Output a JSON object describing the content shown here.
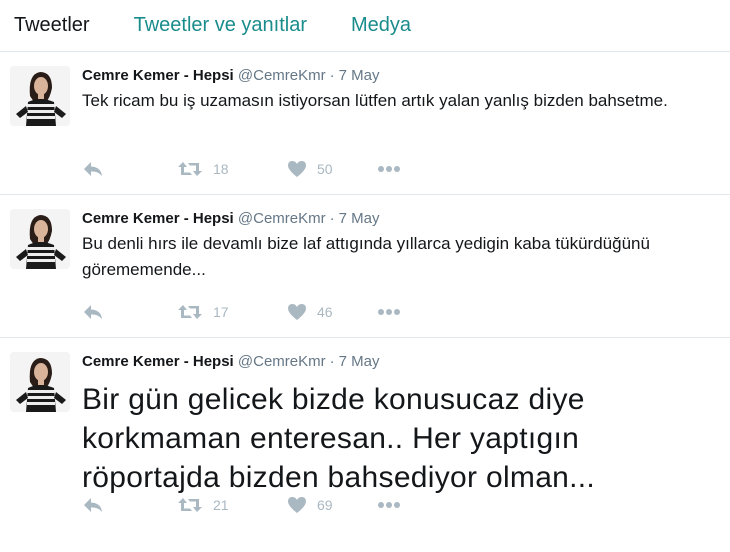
{
  "tabs": [
    {
      "label": "Tweetler",
      "active": true
    },
    {
      "label": "Tweetler ve yanıtlar",
      "active": false
    },
    {
      "label": "Medya",
      "active": false
    }
  ],
  "tweets": [
    {
      "name": "Cemre Kemer - Hepsi",
      "handle": "@CemreKmr",
      "separator": "·",
      "date": "7 May",
      "text": "Tek ricam bu iş uzamasın istiyorsan lütfen artık yalan yanlış bizden bahsetme.",
      "retweets": "18",
      "likes": "50"
    },
    {
      "name": "Cemre Kemer - Hepsi",
      "handle": "@CemreKmr",
      "separator": "·",
      "date": "7 May",
      "text": "Bu denli hırs ile devamlı bize laf attıgında yıllarca  yedigin kaba tükürdüğünü görememende...",
      "retweets": "17",
      "likes": "46"
    },
    {
      "name": "Cemre Kemer - Hepsi",
      "handle": "@CemreKmr",
      "separator": "·",
      "date": "7 May",
      "text": "Bir gün gelicek bizde konusucaz diye korkmaman enteresan.. Her yaptıgın röportajda bizden bahsediyor olman...",
      "retweets": "21",
      "likes": "69"
    }
  ],
  "colors": {
    "accent": "#1b8c8c",
    "muted": "#657786",
    "icon": "#aab8c2",
    "border": "#e1e8ed"
  },
  "icons": [
    "reply-icon",
    "retweet-icon",
    "heart-icon",
    "more-icon"
  ]
}
